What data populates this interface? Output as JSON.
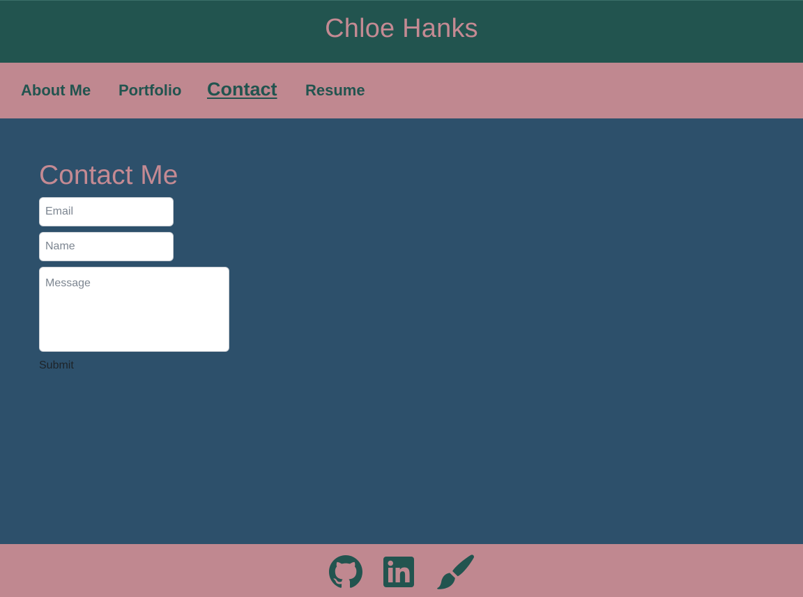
{
  "header": {
    "title": "Chloe Hanks"
  },
  "nav": {
    "items": [
      {
        "label": "About Me"
      },
      {
        "label": "Portfolio"
      },
      {
        "label": "Contact"
      },
      {
        "label": "Resume"
      }
    ],
    "active": "Contact"
  },
  "contact": {
    "heading": "Contact Me",
    "email_placeholder": "Email",
    "name_placeholder": "Name",
    "message_placeholder": "Message",
    "submit_label": "Submit"
  },
  "footer": {
    "icons": [
      "github-icon",
      "linkedin-icon",
      "paintbrush-icon"
    ]
  },
  "colors": {
    "header_bg": "#22544f",
    "nav_bg": "#c08890",
    "main_bg": "#2d506b",
    "accent_pink": "#c48a93",
    "nav_text": "#22544f"
  }
}
